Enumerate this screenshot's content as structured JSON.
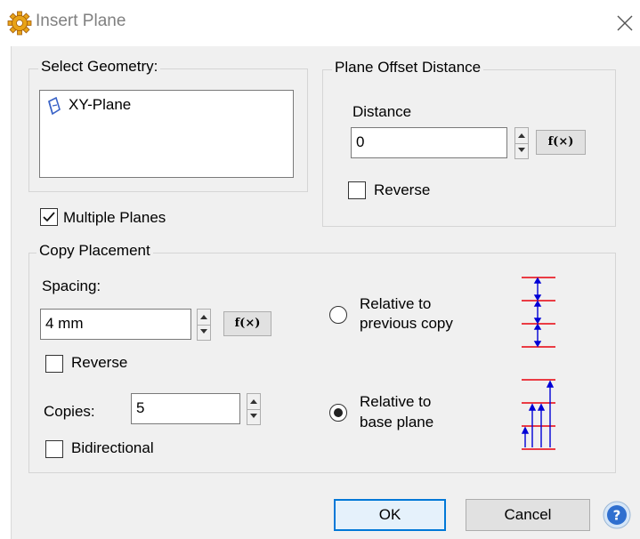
{
  "dialog": {
    "title": "Insert Plane",
    "icon": "gear-icon",
    "accent_color": "#0078d7"
  },
  "select_geometry": {
    "legend": "Select Geometry:",
    "items": [
      {
        "label": "XY-Plane",
        "icon": "plane-icon"
      }
    ]
  },
  "plane_offset": {
    "legend": "Plane Offset Distance",
    "distance_label": "Distance",
    "distance_value": "0",
    "fx_label": "f(×)",
    "reverse_label": "Reverse",
    "reverse_checked": false
  },
  "multiple_planes": {
    "label": "Multiple Planes",
    "checked": true
  },
  "copy_placement": {
    "legend": "Copy Placement",
    "spacing_label": "Spacing:",
    "spacing_value": "4 mm",
    "fx_label": "f(×)",
    "reverse_label": "Reverse",
    "reverse_checked": false,
    "copies_label": "Copies:",
    "copies_value": "5",
    "bidirectional_label": "Bidirectional",
    "bidirectional_checked": false,
    "relative_previous_line1": "Relative to",
    "relative_previous_line2": "previous copy",
    "relative_previous_selected": false,
    "relative_base_line1": "Relative to",
    "relative_base_line2": "base plane",
    "relative_base_selected": true,
    "diagram_plane_color": "#e8000a",
    "diagram_arrow_color": "#0000d6"
  },
  "buttons": {
    "ok": "OK",
    "cancel": "Cancel",
    "help_icon": "help-icon"
  }
}
